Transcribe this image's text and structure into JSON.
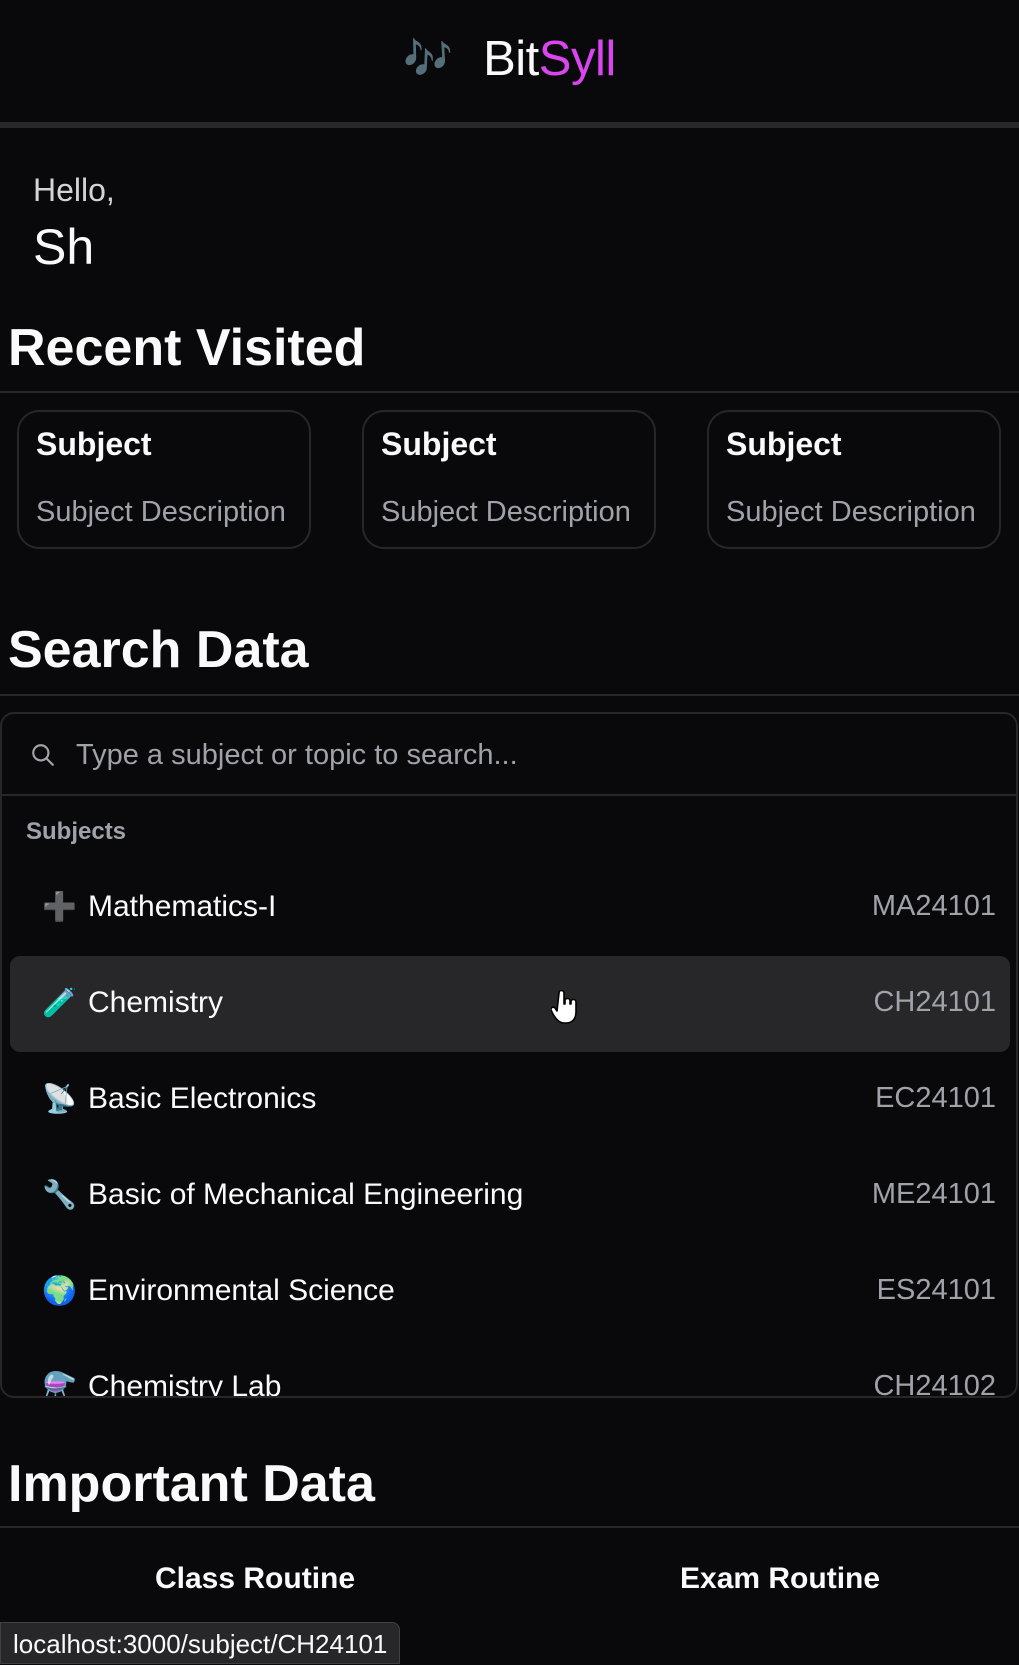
{
  "brand": {
    "icon": "🎶",
    "name_part1": "Bit",
    "name_part2": "Syll",
    "accent_color": "#d946ef"
  },
  "greeting": {
    "hello": "Hello,",
    "username": "Sh"
  },
  "recent": {
    "title": "Recent Visited",
    "cards": [
      {
        "title": "Subject",
        "description": "Subject Description"
      },
      {
        "title": "Subject",
        "description": "Subject Description"
      },
      {
        "title": "Subject",
        "description": "Subject Description"
      }
    ]
  },
  "search": {
    "title": "Search Data",
    "placeholder": "Type a subject or topic to search...",
    "group_heading": "Subjects",
    "items": [
      {
        "icon": "➕",
        "icon_name": "plus-icon",
        "name": "Mathematics-I",
        "code": "MA24101"
      },
      {
        "icon": "🧪",
        "icon_name": "test-tube-icon",
        "name": "Chemistry",
        "code": "CH24101",
        "active": true
      },
      {
        "icon": "📡",
        "icon_name": "satellite-dish-icon",
        "name": "Basic Electronics",
        "code": "EC24101"
      },
      {
        "icon": "🔧",
        "icon_name": "wrench-icon",
        "name": "Basic of Mechanical Engineering",
        "code": "ME24101"
      },
      {
        "icon": "🌍",
        "icon_name": "globe-icon",
        "name": "Environmental Science",
        "code": "ES24101"
      },
      {
        "icon": "⚗️",
        "icon_name": "flask-icon",
        "name": "Chemistry Lab",
        "code": "CH24102"
      }
    ]
  },
  "important": {
    "title": "Important Data",
    "tabs": [
      "Class Routine",
      "Exam Routine"
    ]
  },
  "status_bar": {
    "url": "localhost:3000/subject/CH24101"
  }
}
